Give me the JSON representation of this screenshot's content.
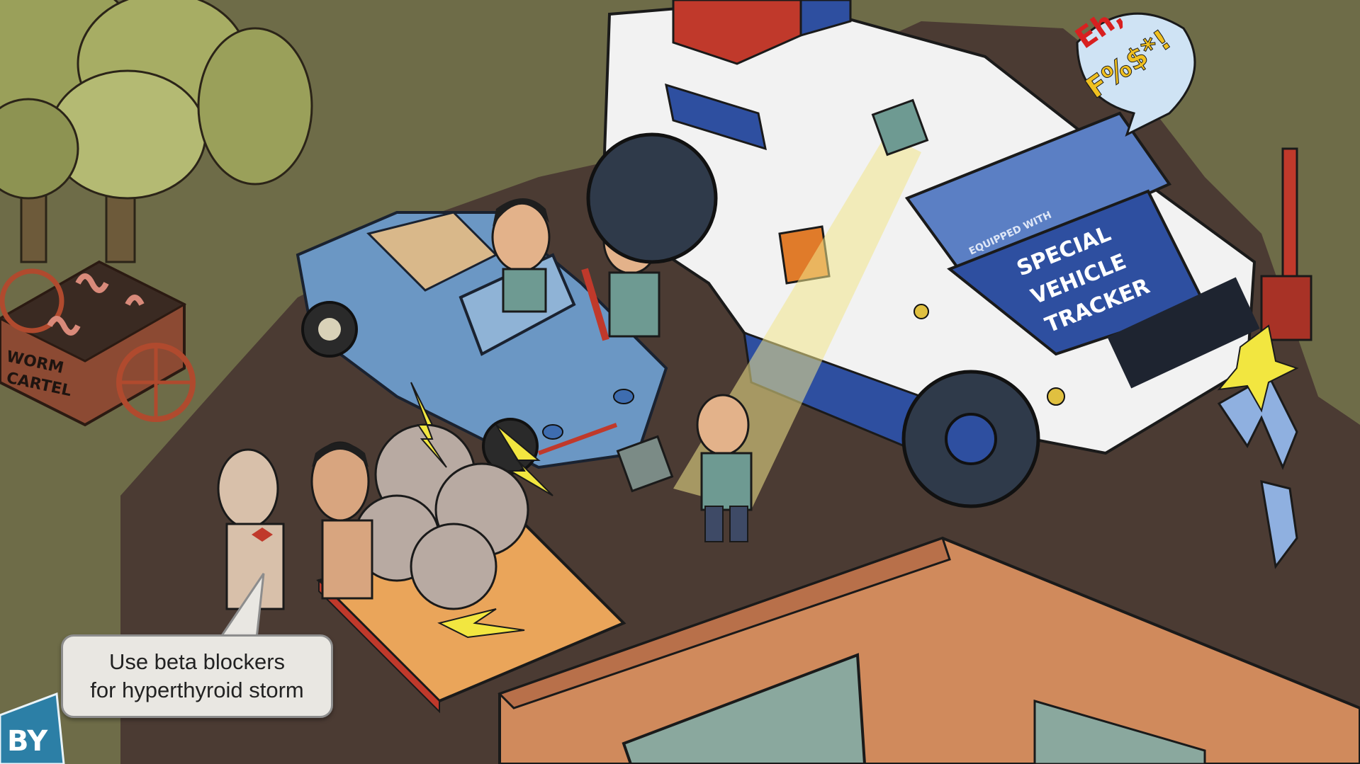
{
  "scene": {
    "caption": {
      "line1": "Use beta blockers",
      "line2": "for hyperthyroid storm"
    },
    "police_speech_bubble": {
      "line1": "Eh,",
      "line2": "F%$*!"
    },
    "vehicle_hood": {
      "small_text": "EQUIPPED WITH",
      "line1": "SPECIAL",
      "line2": "VEHICLE",
      "line3": "TRACKER"
    },
    "cart_sign": {
      "line1": "WORM",
      "line2": "CARTEL"
    },
    "corner_sign": "BY"
  },
  "colors": {
    "grass": "#6e6c48",
    "dirt": "#4b3b33",
    "truck_white": "#f2f2f2",
    "truck_blue": "#2e4fa0",
    "car_blue": "#6b97c4",
    "building_orange": "#d08a5c",
    "spotlight": "#f3e58a",
    "caption_bg": "#e9e7e2"
  }
}
